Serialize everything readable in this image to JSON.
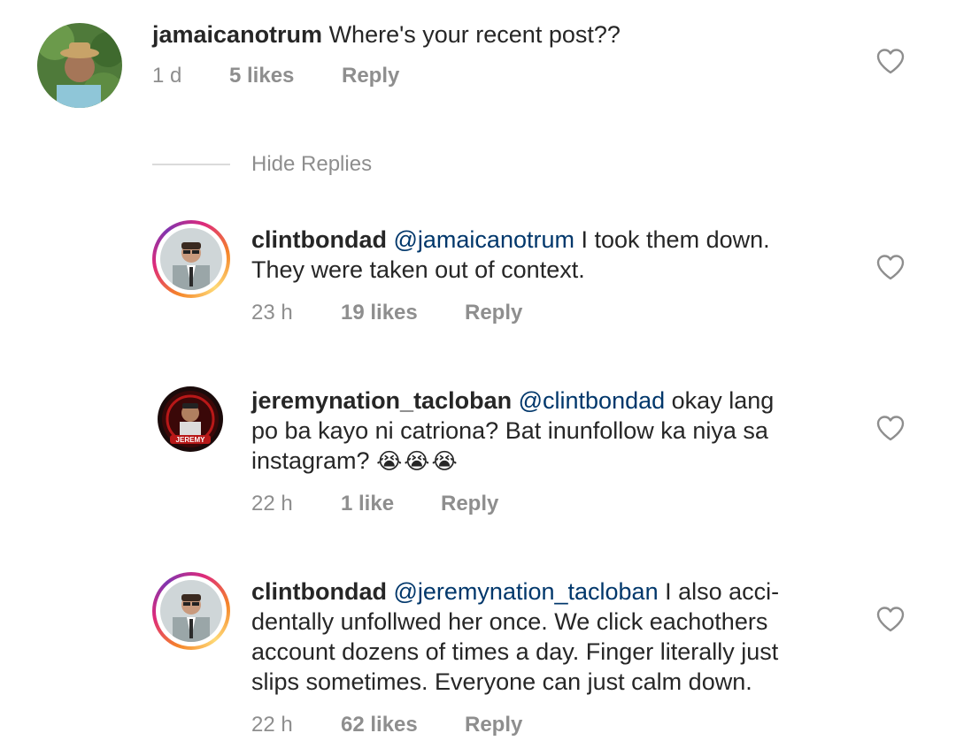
{
  "comments": [
    {
      "username": "jamaicanotrum",
      "mention": "",
      "text": "Where's your recent post??",
      "time": "1 d",
      "likes": "5 likes",
      "reply": "Reply"
    },
    {
      "username": "clintbondad",
      "mention": "@jamaicanotrum",
      "text_line1": "I took them down.",
      "text_line2": "They were taken out of context.",
      "time": "23 h",
      "likes": "19 likes",
      "reply": "Reply"
    },
    {
      "username": "jeremynation_tacloban",
      "mention": "@clintbondad",
      "text_line1": "okay lang",
      "text_line2": "po ba kayo ni catriona? Bat inunfollow ka niya sa",
      "text_line3": "instagram?",
      "emojis": "😭😭😭",
      "time": "22 h",
      "likes": "1 like",
      "reply": "Reply",
      "avatar_badge": "JEREMY"
    },
    {
      "username": "clintbondad",
      "mention": "@jeremynation_tacloban",
      "text_line1": "I also acci-",
      "text_line2": "dentally unfollwed her once. We click eachothers",
      "text_line3": "account dozens of times a day. Finger literally just",
      "text_line4": "slips sometimes. Everyone can just calm down.",
      "time": "22 h",
      "likes": "62 likes",
      "reply": "Reply"
    }
  ],
  "hide_replies_label": "Hide Replies",
  "icons": {
    "like": "heart-outline-icon"
  },
  "colors": {
    "text": "#262626",
    "meta": "#8e8e8e",
    "mention": "#00376b",
    "divider": "#dbdbdb"
  }
}
